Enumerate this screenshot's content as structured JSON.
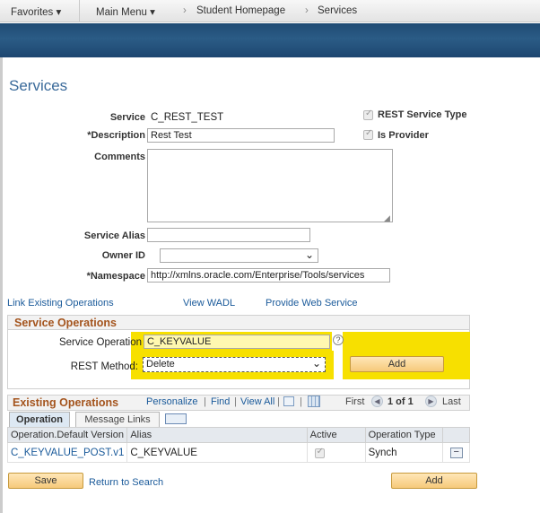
{
  "nav": {
    "favorites": "Favorites ▾",
    "main_menu": "Main Menu ▾",
    "crumb1": "Student Homepage",
    "crumb2": "Services",
    "crumb_sep": "›"
  },
  "page_title": "Services",
  "form": {
    "service_label": "Service",
    "service_value": "C_REST_TEST",
    "description_label": "*Description",
    "description_value": "Rest Test",
    "comments_label": "Comments",
    "comments_value": "",
    "alias_label": "Service Alias",
    "alias_value": "",
    "owner_label": "Owner ID",
    "owner_value": "",
    "namespace_label": "*Namespace",
    "namespace_value": "http://xmlns.oracle.com/Enterprise/Tools/services",
    "rest_service_type_label": "REST Service Type",
    "is_provider_label": "Is Provider"
  },
  "links": {
    "link_existing": "Link Existing Operations",
    "view_wadl": "View WADL",
    "provide_web_service": "Provide Web Service",
    "return_to_search": "Return to Search"
  },
  "service_operations": {
    "title": "Service Operations",
    "service_operation_label": "Service Operation",
    "service_operation_value": "C_KEYVALUE",
    "rest_method_label": "REST Method:",
    "rest_method_value": "Delete",
    "add_label": "Add",
    "help_glyph": "?"
  },
  "existing_operations": {
    "title": "Existing Operations",
    "personalize": "Personalize",
    "find": "Find",
    "view_all": "View All",
    "sep": "|",
    "first": "First",
    "count": "1 of 1",
    "last": "Last",
    "tabs": [
      "Operation",
      "Message Links"
    ],
    "columns": [
      "Operation.Default Version",
      "Alias",
      "Active",
      "Operation Type"
    ],
    "rows": [
      {
        "operation": "C_KEYVALUE_POST.v1",
        "alias": "C_KEYVALUE",
        "operation_type": "Synch"
      }
    ],
    "remove_glyph": "−"
  },
  "footer": {
    "save_label": "Save",
    "add_label": "Add"
  },
  "colors": {
    "highlight": "#f7e000",
    "section_title": "#a4541d",
    "link": "#1a5a9a",
    "banner": "#234f7a"
  }
}
